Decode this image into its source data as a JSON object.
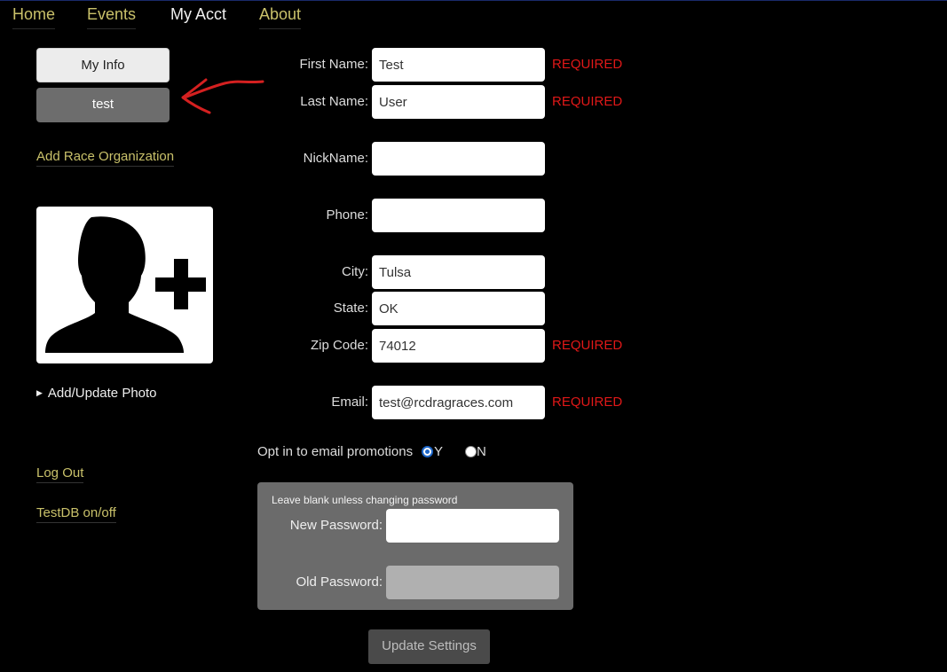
{
  "nav": {
    "home": "Home",
    "events": "Events",
    "my_acct": "My Acct",
    "about": "About"
  },
  "sidebar": {
    "my_info": "My Info",
    "profile_button": "test",
    "add_race_org": "Add Race Organization",
    "photo_toggle": "Add/Update Photo",
    "log_out": "Log Out",
    "testdb": "TestDB on/off"
  },
  "form": {
    "first_name": {
      "label": "First Name:",
      "value": "Test",
      "required": "REQUIRED"
    },
    "last_name": {
      "label": "Last Name:",
      "value": "User",
      "required": "REQUIRED"
    },
    "nickname": {
      "label": "NickName:",
      "value": ""
    },
    "phone": {
      "label": "Phone:",
      "value": ""
    },
    "city": {
      "label": "City:",
      "value": "Tulsa"
    },
    "state": {
      "label": "State:",
      "value": "OK"
    },
    "zip": {
      "label": "Zip Code:",
      "value": "74012",
      "required": "REQUIRED"
    },
    "email": {
      "label": "Email:",
      "value": "test@rcdragraces.com",
      "required": "REQUIRED"
    }
  },
  "optin": {
    "label": "Opt in to email promotions",
    "yes": "Y",
    "no": "N",
    "selected": "Y"
  },
  "password": {
    "note": "Leave blank unless changing password",
    "new_label": "New Password:",
    "old_label": "Old Password:"
  },
  "update_button": "Update Settings",
  "colors": {
    "accent_link": "#c9c16a",
    "required": "#e01818",
    "arrow": "#d42020"
  }
}
